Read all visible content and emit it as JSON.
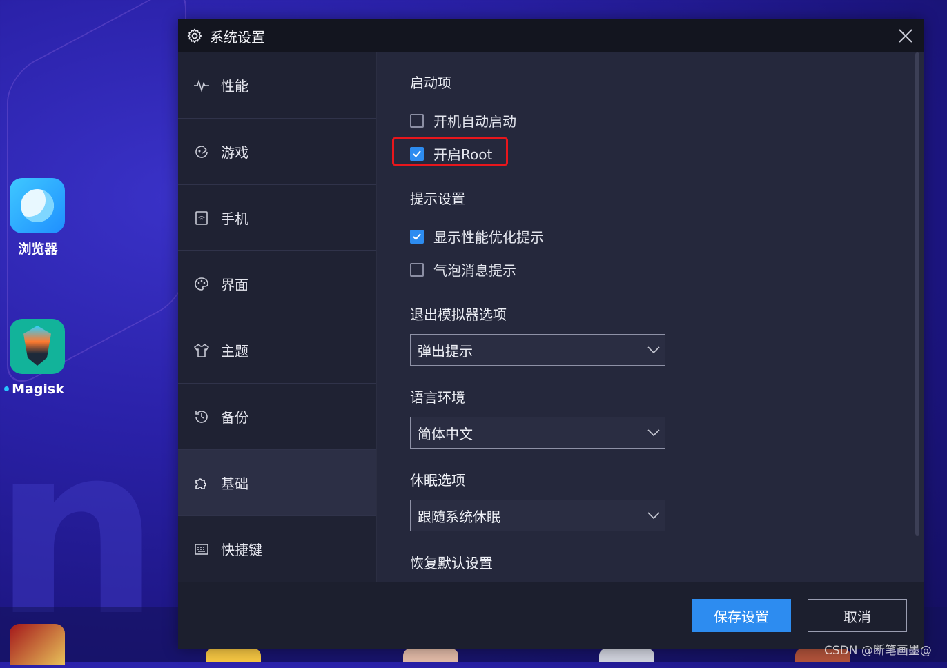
{
  "desktop": {
    "icons": [
      {
        "label": "浏览器"
      },
      {
        "label": "Magisk"
      }
    ]
  },
  "dialog": {
    "title": "系统设置",
    "sidebar": {
      "items": [
        {
          "label": "性能",
          "icon": "pulse-icon",
          "active": false
        },
        {
          "label": "游戏",
          "icon": "gamepad-icon",
          "active": false
        },
        {
          "label": "手机",
          "icon": "phone-icon",
          "active": false
        },
        {
          "label": "界面",
          "icon": "palette-icon",
          "active": false
        },
        {
          "label": "主题",
          "icon": "shirt-icon",
          "active": false
        },
        {
          "label": "备份",
          "icon": "history-icon",
          "active": false
        },
        {
          "label": "基础",
          "icon": "puzzle-icon",
          "active": true
        },
        {
          "label": "快捷键",
          "icon": "keyboard-icon",
          "active": false
        }
      ]
    },
    "content": {
      "startup": {
        "title": "启动项",
        "options": [
          {
            "label": "开机自动启动",
            "checked": false
          },
          {
            "label": "开启Root",
            "checked": true
          }
        ]
      },
      "hints": {
        "title": "提示设置",
        "options": [
          {
            "label": "显示性能优化提示",
            "checked": true
          },
          {
            "label": "气泡消息提示",
            "checked": false
          }
        ]
      },
      "exit": {
        "title": "退出模拟器选项",
        "value": "弹出提示"
      },
      "language": {
        "title": "语言环境",
        "value": "简体中文"
      },
      "sleep": {
        "title": "休眠选项",
        "value": "跟随系统休眠"
      },
      "restore": {
        "title": "恢复默认设置"
      }
    },
    "footer": {
      "save_label": "保存设置",
      "cancel_label": "取消"
    }
  },
  "watermark": "CSDN @断笔画墨@",
  "colors": {
    "accent": "#2d8cf0",
    "highlight": "#e8161c",
    "dialog_bg": "#25283c",
    "sidebar_bg": "#1f2233"
  }
}
